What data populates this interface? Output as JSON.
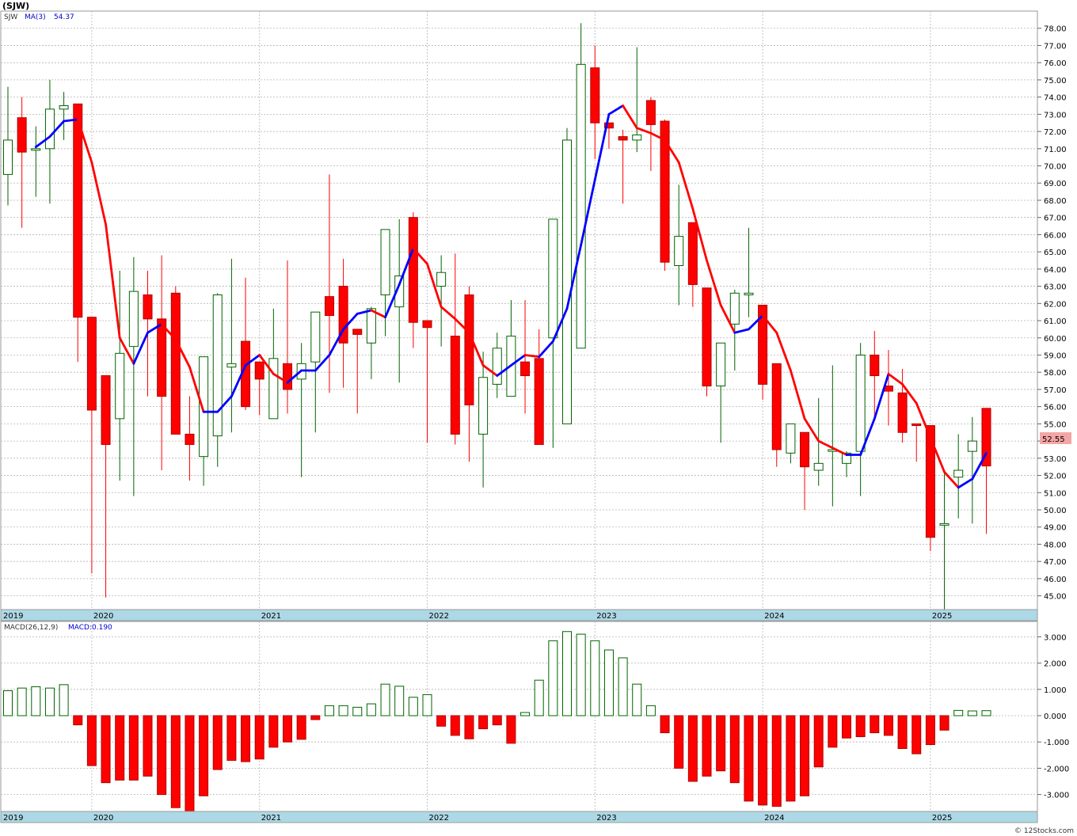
{
  "header": {
    "symbol": "(SJW)"
  },
  "watermark": "© 12Stocks.com",
  "colors": {
    "up": "#006400",
    "down": "#ff0000",
    "ma_up": "#0000ff",
    "ma_down": "#ff0000",
    "axis_band": "#add8e6",
    "last_price_bg": "#f4a6a6"
  },
  "price_panel": {
    "legend": {
      "symbol": "SJW",
      "ma_label": "MA(3)",
      "ma_value": "54.37"
    },
    "last_price_label": "52.55",
    "y_ticks": [
      "78.00",
      "77.00",
      "76.00",
      "75.00",
      "74.00",
      "73.00",
      "72.00",
      "71.00",
      "70.00",
      "69.00",
      "68.00",
      "67.00",
      "66.00",
      "65.00",
      "64.00",
      "63.00",
      "62.00",
      "61.00",
      "60.00",
      "59.00",
      "58.00",
      "57.00",
      "56.00",
      "55.00",
      "54.00",
      "53.00",
      "52.00",
      "51.00",
      "50.00",
      "49.00",
      "48.00",
      "47.00",
      "46.00",
      "45.00"
    ],
    "x_labels": [
      "2019",
      "2020",
      "2021",
      "2022",
      "2023",
      "2024",
      "2025"
    ]
  },
  "macd_panel": {
    "legend": {
      "label": "MACD(26,12,9)",
      "value_label": "MACD:0.190"
    },
    "y_ticks": [
      "3.000",
      "2.000",
      "1.000",
      "0.000",
      "-1.000",
      "-2.000",
      "-3.000"
    ],
    "x_labels": [
      "2019",
      "2020",
      "2021",
      "2022",
      "2023",
      "2024",
      "2025"
    ]
  },
  "chart_data": [
    {
      "type": "candlestick",
      "title": "(SJW)",
      "interval": "monthly",
      "ylim": [
        44.2,
        79
      ],
      "x_dates": [
        "2019-07",
        "2019-08",
        "2019-09",
        "2019-10",
        "2019-11",
        "2019-12",
        "2020-01",
        "2020-02",
        "2020-03",
        "2020-04",
        "2020-05",
        "2020-06",
        "2020-07",
        "2020-08",
        "2020-09",
        "2020-10",
        "2020-11",
        "2020-12",
        "2021-01",
        "2021-02",
        "2021-03",
        "2021-04",
        "2021-05",
        "2021-06",
        "2021-07",
        "2021-08",
        "2021-09",
        "2021-10",
        "2021-11",
        "2021-12",
        "2022-01",
        "2022-02",
        "2022-03",
        "2022-04",
        "2022-05",
        "2022-06",
        "2022-07",
        "2022-08",
        "2022-09",
        "2022-10",
        "2022-11",
        "2022-12",
        "2023-01",
        "2023-02",
        "2023-03",
        "2023-04",
        "2023-05",
        "2023-06",
        "2023-07",
        "2023-08",
        "2023-09",
        "2023-10",
        "2023-11",
        "2023-12",
        "2024-01",
        "2024-02",
        "2024-03",
        "2024-04",
        "2024-05",
        "2024-06",
        "2024-07",
        "2024-08",
        "2024-09",
        "2024-10",
        "2024-11",
        "2024-12",
        "2025-01",
        "2025-02",
        "2025-03",
        "2025-04",
        "2025-05"
      ],
      "open": [
        69.5,
        72.8,
        71.0,
        71.0,
        73.3,
        73.6,
        61.2,
        57.8,
        55.3,
        59.5,
        62.5,
        61.1,
        62.6,
        54.4,
        53.1,
        54.3,
        58.3,
        59.8,
        58.6,
        55.3,
        58.5,
        57.6,
        58.6,
        62.4,
        63.0,
        60.5,
        59.7,
        62.5,
        61.8,
        67.0,
        61.0,
        63.0,
        60.1,
        62.5,
        54.4,
        57.3,
        56.6,
        58.6,
        58.8,
        60.0,
        55.0,
        59.4,
        75.7,
        72.5,
        71.7,
        71.5,
        73.8,
        72.6,
        64.2,
        66.7,
        62.9,
        57.2,
        60.8,
        62.5,
        61.9,
        58.5,
        53.3,
        54.5,
        52.3,
        53.4,
        52.7,
        53.4,
        59.0,
        57.2,
        56.8,
        55.0,
        54.9,
        49.2,
        51.9,
        53.4,
        55.9
      ],
      "close": [
        71.5,
        70.8,
        71.0,
        73.3,
        73.5,
        61.2,
        55.8,
        53.8,
        59.1,
        62.7,
        61.1,
        56.6,
        54.4,
        53.8,
        58.9,
        62.5,
        58.5,
        56.0,
        57.6,
        58.8,
        57.0,
        58.5,
        61.5,
        61.3,
        59.7,
        60.2,
        61.7,
        66.3,
        63.6,
        60.9,
        60.6,
        63.8,
        54.4,
        56.1,
        57.7,
        59.4,
        60.1,
        57.8,
        53.8,
        66.9,
        71.5,
        75.9,
        72.5,
        72.2,
        71.5,
        71.8,
        72.4,
        64.4,
        65.9,
        63.1,
        57.2,
        59.7,
        62.6,
        62.6,
        57.3,
        53.5,
        55.0,
        52.5,
        52.7,
        53.5,
        53.3,
        59.0,
        57.8,
        56.9,
        54.5,
        54.9,
        48.4,
        49.2,
        52.3,
        54.0,
        52.55
      ],
      "high": [
        74.6,
        74.0,
        72.3,
        75.0,
        74.3,
        70.8,
        57.4,
        55.2,
        63.9,
        64.7,
        63.9,
        64.8,
        63.0,
        56.6,
        58.9,
        62.6,
        64.6,
        63.5,
        57.6,
        61.7,
        64.5,
        59.7,
        61.0,
        69.5,
        64.6,
        60.5,
        61.8,
        66.0,
        66.9,
        67.3,
        61.0,
        64.8,
        64.9,
        63.0,
        59.2,
        60.3,
        62.2,
        62.2,
        60.5,
        66.4,
        72.2,
        78.3,
        77.0,
        72.2,
        72.1,
        76.9,
        74.0,
        72.7,
        68.9,
        66.4,
        62.9,
        59.7,
        62.8,
        66.4,
        60.7,
        57.9,
        54.9,
        54.3,
        56.5,
        58.4,
        53.4,
        59.7,
        60.4,
        59.3,
        58.2,
        55.0,
        52.6,
        52.2,
        54.4,
        55.4,
        55.5
      ],
      "low": [
        67.7,
        66.4,
        68.2,
        67.8,
        71.5,
        58.6,
        46.3,
        44.9,
        51.7,
        50.8,
        56.6,
        52.3,
        54.4,
        51.7,
        51.4,
        52.5,
        54.5,
        55.8,
        55.5,
        55.8,
        55.6,
        51.9,
        54.5,
        56.8,
        57.1,
        55.6,
        57.6,
        60.1,
        57.4,
        59.4,
        53.9,
        59.5,
        53.8,
        52.8,
        51.3,
        56.5,
        56.7,
        55.6,
        53.8,
        53.6,
        63.0,
        68.9,
        70.4,
        71.0,
        67.8,
        70.8,
        69.7,
        63.9,
        61.9,
        61.8,
        56.6,
        53.9,
        58.1,
        61.2,
        56.4,
        52.5,
        52.7,
        50.0,
        51.4,
        50.2,
        51.9,
        50.8,
        55.4,
        54.9,
        53.9,
        52.8,
        47.6,
        43.9,
        49.5,
        49.2,
        48.6
      ]
    },
    {
      "type": "line",
      "name": "MA(3)",
      "x_dates": [
        "2019-09",
        "2019-10",
        "2019-11",
        "2019-12",
        "2020-01",
        "2020-02",
        "2020-03",
        "2020-04",
        "2020-05",
        "2020-06",
        "2020-07",
        "2020-08",
        "2020-09",
        "2020-10",
        "2020-11",
        "2020-12",
        "2021-01",
        "2021-02",
        "2021-03",
        "2021-04",
        "2021-05",
        "2021-06",
        "2021-07",
        "2021-08",
        "2021-09",
        "2021-10",
        "2021-11",
        "2021-12",
        "2022-01",
        "2022-02",
        "2022-03",
        "2022-04",
        "2022-05",
        "2022-06",
        "2022-07",
        "2022-08",
        "2022-09",
        "2022-10",
        "2022-11",
        "2022-12",
        "2023-01",
        "2023-02",
        "2023-03",
        "2023-04",
        "2023-05",
        "2023-06",
        "2023-07",
        "2023-08",
        "2023-09",
        "2023-10",
        "2023-11",
        "2023-12",
        "2024-01",
        "2024-02",
        "2024-03",
        "2024-04",
        "2024-05",
        "2024-06",
        "2024-07",
        "2024-08",
        "2024-09",
        "2024-10",
        "2024-11",
        "2024-12",
        "2025-01",
        "2025-02",
        "2025-03",
        "2025-04",
        "2025-05"
      ],
      "values": [
        71.1,
        71.7,
        72.6,
        72.7,
        70.2,
        66.6,
        60.0,
        58.5,
        60.3,
        60.8,
        59.9,
        58.3,
        55.7,
        55.7,
        56.6,
        58.4,
        59.0,
        57.9,
        57.4,
        58.1,
        58.1,
        59.0,
        60.5,
        61.4,
        61.6,
        61.2,
        63.1,
        65.2,
        64.3,
        61.8,
        61.1,
        60.3,
        58.4,
        57.8,
        58.4,
        59.0,
        58.9,
        59.8,
        61.7,
        65.4,
        69.2,
        73.0,
        73.5,
        72.2,
        71.9,
        71.5,
        70.2,
        67.5,
        64.5,
        61.9,
        60.3,
        60.5,
        61.3,
        60.3,
        58.1,
        55.3,
        54.0,
        53.6,
        53.2,
        53.2,
        55.3,
        57.9,
        57.3,
        56.2,
        54.2,
        52.2,
        51.3,
        51.8,
        53.3
      ]
    },
    {
      "type": "bar",
      "name": "MACD(26,12,9)",
      "x_dates": [
        "2019-07",
        "2019-08",
        "2019-09",
        "2019-10",
        "2019-11",
        "2019-12",
        "2020-01",
        "2020-02",
        "2020-03",
        "2020-04",
        "2020-05",
        "2020-06",
        "2020-07",
        "2020-08",
        "2020-09",
        "2020-10",
        "2020-11",
        "2020-12",
        "2021-01",
        "2021-02",
        "2021-03",
        "2021-04",
        "2021-05",
        "2021-06",
        "2021-07",
        "2021-08",
        "2021-09",
        "2021-10",
        "2021-11",
        "2021-12",
        "2022-01",
        "2022-02",
        "2022-03",
        "2022-04",
        "2022-05",
        "2022-06",
        "2022-07",
        "2022-08",
        "2022-09",
        "2022-10",
        "2022-11",
        "2022-12",
        "2023-01",
        "2023-02",
        "2023-03",
        "2023-04",
        "2023-05",
        "2023-06",
        "2023-07",
        "2023-08",
        "2023-09",
        "2023-10",
        "2023-11",
        "2023-12",
        "2024-01",
        "2024-02",
        "2024-03",
        "2024-04",
        "2024-05",
        "2024-06",
        "2024-07",
        "2024-08",
        "2024-09",
        "2024-10",
        "2024-11",
        "2024-12",
        "2025-01",
        "2025-02",
        "2025-03",
        "2025-04",
        "2025-05"
      ],
      "values": [
        0.95,
        1.05,
        1.1,
        1.05,
        1.18,
        -0.35,
        -1.9,
        -2.55,
        -2.45,
        -2.45,
        -2.3,
        -3.0,
        -3.5,
        -3.7,
        -3.05,
        -2.05,
        -1.7,
        -1.75,
        -1.65,
        -1.2,
        -1.0,
        -0.9,
        -0.15,
        0.38,
        0.38,
        0.32,
        0.45,
        1.2,
        1.12,
        0.7,
        0.8,
        -0.4,
        -0.75,
        -0.88,
        -0.5,
        -0.35,
        -1.05,
        0.12,
        1.35,
        2.85,
        3.2,
        3.1,
        2.85,
        2.5,
        2.2,
        1.2,
        0.38,
        -0.65,
        -2.0,
        -2.5,
        -2.3,
        -2.1,
        -2.55,
        -3.25,
        -3.4,
        -3.45,
        -3.25,
        -3.05,
        -1.95,
        -1.2,
        -0.85,
        -0.8,
        -0.65,
        -0.75,
        -1.25,
        -1.45,
        -1.1,
        -0.55,
        0.2,
        0.18,
        0.19
      ],
      "ylim": [
        -3.7,
        3.2
      ]
    }
  ]
}
